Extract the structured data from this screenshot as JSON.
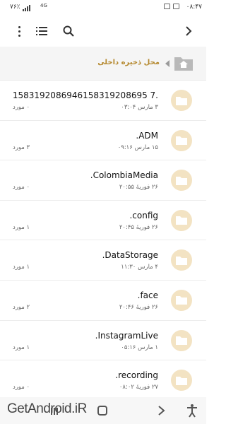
{
  "status_bar": {
    "time": "۰۸:۴۷",
    "battery": "۷۶٪",
    "network": "4G"
  },
  "toolbar": {
    "menu_icon": "more-vert-icon",
    "list_icon": "list-view-icon",
    "search_icon": "search-icon",
    "forward_icon": "chevron-right-icon"
  },
  "breadcrumb": {
    "label": "محل ذخیره داخلی",
    "home_icon": "home-folder-icon"
  },
  "files": [
    {
      "name": "1583192086946158319208695 7.",
      "date": "۳ مارس ۰۳:۰۴",
      "count": "۰ مورد"
    },
    {
      "name": ".ADM",
      "date": "۱۵ مارس ۰۹:۱۶",
      "count": "۳ مورد"
    },
    {
      "name": ".ColombiaMedia",
      "date": "۲۶ فوریهٔ ۲۰:۵۵",
      "count": "۰ مورد"
    },
    {
      "name": ".config",
      "date": "۲۶ فوریهٔ ۲۰:۴۵",
      "count": "۱ مورد"
    },
    {
      "name": ".DataStorage",
      "date": "۴ مارس ۱۱:۳۰",
      "count": "۱ مورد"
    },
    {
      "name": ".face",
      "date": "۲۶ فوریهٔ ۲۰:۴۶",
      "count": "۲ مورد"
    },
    {
      "name": ".InstagramLive",
      "date": "۱ مارس ۰۵:۱۶",
      "count": "۱ مورد"
    },
    {
      "name": ".recording",
      "date": "۲۷ فوریهٔ ۰۸:۰۲",
      "count": "۰ مورد"
    }
  ],
  "watermark": "GetAndroid.iR",
  "colors": {
    "accent": "#b5892f",
    "folder_bg": "#f3e3c3",
    "folder_icon": "#ffffff"
  }
}
